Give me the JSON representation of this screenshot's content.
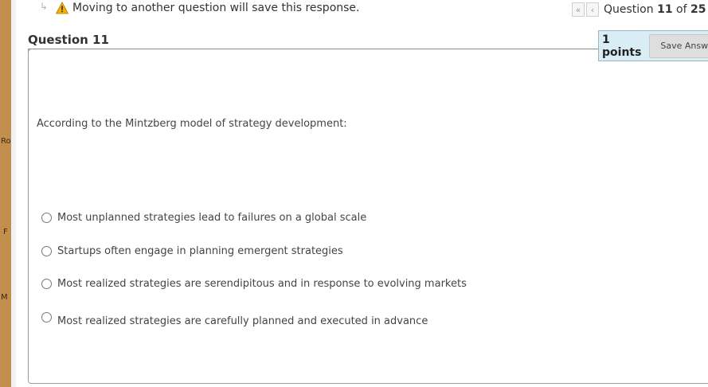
{
  "side_strip": {
    "letters": [
      "Ro",
      "F",
      "M"
    ]
  },
  "warning": {
    "arrow_icon": "↳",
    "icon": "warning-icon",
    "text": "Moving to another question will save this response."
  },
  "navigation": {
    "first_glyph": "«",
    "prev_glyph": "‹",
    "next_glyph": "›",
    "label_prefix": "Question",
    "current": "11",
    "of_label": "of",
    "total": "25"
  },
  "question": {
    "title": "Question 11",
    "points": "1 points",
    "save_label": "Save Answer",
    "prompt": "According to the Mintzberg model of strategy development:",
    "options": [
      "Most unplanned strategies lead to failures on a global scale",
      "Startups often engage in planning emergent strategies",
      "Most realized strategies are serendipitous and in response to evolving markets",
      "Most realized strategies are carefully planned and executed in advance"
    ],
    "selected": null
  },
  "colors": {
    "side_strip": "#c28f4f",
    "points_bg": "#d8edf4",
    "warning": "#f0b400"
  }
}
